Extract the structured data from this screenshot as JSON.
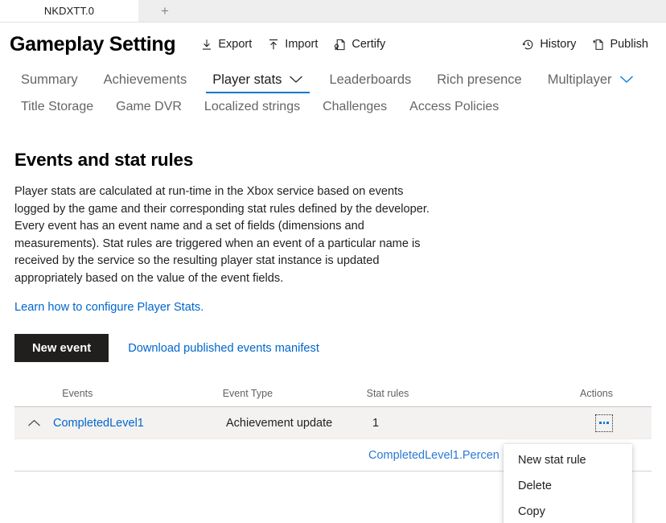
{
  "browser": {
    "active_tab_label": "NKDXTT.0",
    "new_tab_label": "+"
  },
  "header": {
    "title": "Gameplay Setting",
    "left_commands": [
      {
        "label": "Export",
        "icon": "download-arrow-icon"
      },
      {
        "label": "Import",
        "icon": "upload-arrow-icon"
      },
      {
        "label": "Certify",
        "icon": "certificate-document-icon"
      }
    ],
    "right_commands": [
      {
        "label": "History",
        "icon": "clock-history-icon"
      },
      {
        "label": "Publish",
        "icon": "publish-document-icon"
      }
    ]
  },
  "nav": {
    "row1": [
      {
        "label": "Summary",
        "active": false,
        "chevron": "none"
      },
      {
        "label": "Achievements",
        "active": false,
        "chevron": "none"
      },
      {
        "label": "Player stats",
        "active": true,
        "chevron": "dark"
      },
      {
        "label": "Leaderboards",
        "active": false,
        "chevron": "none"
      },
      {
        "label": "Rich presence",
        "active": false,
        "chevron": "none"
      },
      {
        "label": "Multiplayer",
        "active": false,
        "chevron": "blue"
      }
    ],
    "row2": [
      {
        "label": "Title Storage"
      },
      {
        "label": "Game DVR"
      },
      {
        "label": "Localized strings"
      },
      {
        "label": "Challenges"
      },
      {
        "label": "Access Policies"
      }
    ]
  },
  "main": {
    "section_title": "Events and stat rules",
    "description": "Player stats are calculated at run-time in the Xbox service based on events logged by the game and their corresponding stat rules defined by the developer. Every event has an event name and a set of fields (dimensions and measurements). Stat rules are triggered when an event of a particular name is received by the service so the resulting player stat instance is updated appropriately based on the value of the event fields.",
    "learn_link": "Learn how to configure Player Stats.",
    "new_event_button": "New event",
    "download_manifest_link": "Download published events manifest"
  },
  "table": {
    "columns": [
      "Events",
      "Event Type",
      "Stat rules",
      "Actions"
    ],
    "rows": [
      {
        "expanded": true,
        "event": "CompletedLevel1",
        "event_type": "Achievement update",
        "stat_rules": "1",
        "action_icon": "ellipsis-icon"
      }
    ],
    "subrow": {
      "stat_rule_name": "CompletedLevel1.Percen"
    }
  },
  "context_menu": {
    "items": [
      {
        "label": "New stat rule"
      },
      {
        "label": "Delete"
      },
      {
        "label": "Copy"
      }
    ]
  },
  "colors": {
    "accent": "#0078d4",
    "link": "#0066cc",
    "primary_button_bg": "#201f1e",
    "row_highlight": "#f3f2f1"
  }
}
